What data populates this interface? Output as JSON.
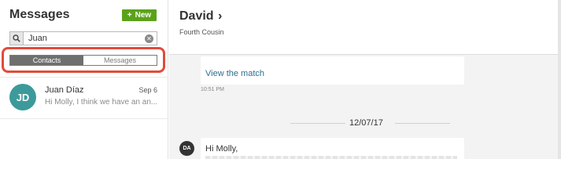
{
  "left": {
    "title": "Messages",
    "new_button": {
      "icon": "+",
      "label": "New"
    },
    "search": {
      "value": "Juan",
      "placeholder": ""
    },
    "tabs": [
      {
        "label": "Contacts",
        "active": true
      },
      {
        "label": "Messages",
        "active": false
      }
    ],
    "contacts": [
      {
        "initials": "JD",
        "name": "Juan Díaz",
        "date": "Sep 6",
        "preview": "Hi Molly, I think we have an an..."
      }
    ]
  },
  "conversation": {
    "name": "David",
    "chevron": "›",
    "relationship": "Fourth Cousin",
    "messages": [
      {
        "link": "View the match",
        "time": "10:51 PM"
      },
      {
        "avatar": "DA",
        "text": "Hi Molly,"
      }
    ],
    "date_separator": "12/07/17"
  },
  "colors": {
    "accent_green": "#5aa21a",
    "highlight_red": "#e24b3b",
    "avatar_teal": "#3c9a9a",
    "link_blue": "#2a6f8f"
  },
  "icons": {
    "search": "search-icon",
    "clear": "clear-icon",
    "chevron": "chevron-right-icon"
  }
}
